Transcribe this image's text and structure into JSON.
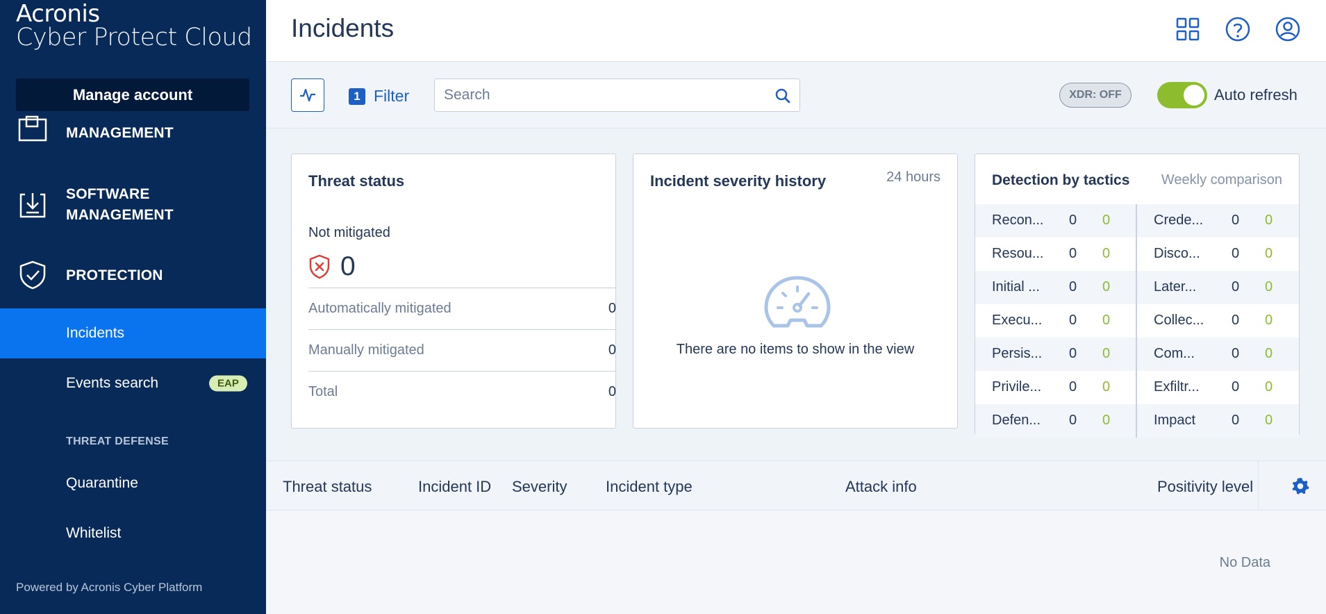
{
  "app": {
    "brand_line1": "Acronis",
    "brand_line2": "Cyber Protect Cloud",
    "page_title": "Incidents",
    "accent_color": "#0a74ee"
  },
  "sidebar": {
    "manage_account": "Manage account",
    "items": [
      {
        "label": "MANAGEMENT",
        "icon": "management-icon"
      },
      {
        "label1": "SOFTWARE",
        "label2": "MANAGEMENT",
        "icon": "software-management-icon"
      },
      {
        "label": "PROTECTION",
        "icon": "shield-check-icon"
      }
    ],
    "subitems": [
      {
        "label": "Incidents",
        "active": true
      },
      {
        "label": "Events search",
        "badge": "EAP"
      }
    ],
    "section_threat_defense": "THREAT DEFENSE",
    "threat_items": [
      {
        "label": "Quarantine"
      },
      {
        "label": "Whitelist"
      }
    ],
    "powered_by": "Powered by Acronis Cyber Platform"
  },
  "toolbar": {
    "filter_count": "1",
    "filter_label": "Filter",
    "search_placeholder": "Search",
    "xdr_label": "XDR: OFF",
    "auto_refresh_label": "Auto refresh",
    "auto_refresh_on": true
  },
  "threat_status": {
    "title": "Threat status",
    "not_mitigated_label": "Not mitigated",
    "not_mitigated_value": "0",
    "rows": [
      {
        "label": "Automatically mitigated",
        "value": "0"
      },
      {
        "label": "Manually mitigated",
        "value": "0"
      },
      {
        "label": "Total",
        "value": "0"
      }
    ]
  },
  "severity_history": {
    "title": "Incident severity history",
    "period": "24 hours",
    "empty_text": "There are no items to show in the view"
  },
  "tactics": {
    "title": "Detection by tactics",
    "subtitle": "Weekly comparison",
    "rows": [
      [
        {
          "name": "Recon...",
          "a": "0",
          "b": "0"
        },
        {
          "name": "Crede...",
          "a": "0",
          "b": "0"
        }
      ],
      [
        {
          "name": "Resou...",
          "a": "0",
          "b": "0"
        },
        {
          "name": "Disco...",
          "a": "0",
          "b": "0"
        }
      ],
      [
        {
          "name": "Initial ...",
          "a": "0",
          "b": "0"
        },
        {
          "name": "Later...",
          "a": "0",
          "b": "0"
        }
      ],
      [
        {
          "name": "Execu...",
          "a": "0",
          "b": "0"
        },
        {
          "name": "Collec...",
          "a": "0",
          "b": "0"
        }
      ],
      [
        {
          "name": "Persis...",
          "a": "0",
          "b": "0"
        },
        {
          "name": "Com...",
          "a": "0",
          "b": "0"
        }
      ],
      [
        {
          "name": "Privile...",
          "a": "0",
          "b": "0"
        },
        {
          "name": "Exfiltr...",
          "a": "0",
          "b": "0"
        }
      ],
      [
        {
          "name": "Defen...",
          "a": "0",
          "b": "0"
        },
        {
          "name": "Impact",
          "a": "0",
          "b": "0"
        }
      ]
    ]
  },
  "table": {
    "columns": [
      "Threat status",
      "Incident ID",
      "Severity",
      "Incident type",
      "Attack info",
      "Positivity level"
    ],
    "empty_text": "No Data"
  }
}
